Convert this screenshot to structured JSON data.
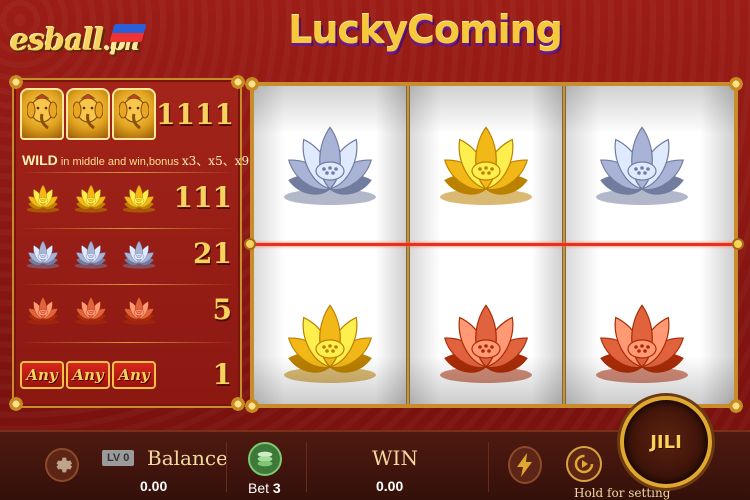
{
  "logo": {
    "text": "esball",
    "suffix": ".ph"
  },
  "title": "LuckyComing",
  "paytable": {
    "rows": [
      {
        "symbol": "ganesha-wild",
        "count": 3,
        "pay": "1111"
      },
      {
        "symbol": "gold-lotus",
        "count": 3,
        "pay": "111"
      },
      {
        "symbol": "silver-lotus",
        "count": 3,
        "pay": "21"
      },
      {
        "symbol": "copper-lotus",
        "count": 3,
        "pay": "5"
      },
      {
        "symbol": "any",
        "count": 3,
        "pay": "1",
        "label": "Any"
      }
    ],
    "wild_note": {
      "lead": "WILD",
      "text": " in middle and win,bonus ",
      "multipliers": "x3、x5、x9"
    }
  },
  "reels": {
    "top": [
      "silver-lotus",
      "gold-lotus",
      "silver-lotus"
    ],
    "bottom": [
      "gold-lotus",
      "copper-lotus",
      "copper-lotus"
    ]
  },
  "colors": {
    "gold-lotus": "#f2b817",
    "silver-lotus": "#a9b3d6",
    "copper-lotus": "#e0633e"
  },
  "bottom": {
    "level_badge": "LV 0",
    "balance_label": "Balance",
    "balance_value": "0.00",
    "bet_label": "Bet",
    "bet_value": "3",
    "win_label": "WIN",
    "win_value": "0.00",
    "hold_text": "Hold for setting",
    "spin_label": "JILI"
  }
}
